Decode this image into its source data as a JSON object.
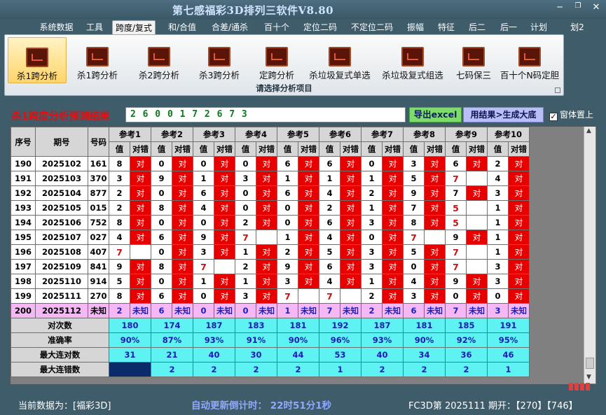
{
  "window": {
    "title": "第七感福彩3D排列三软件V8.80"
  },
  "menu": [
    "系统数据",
    "工具",
    "跨度/复式",
    "和/合值",
    "合差/通杀",
    "百十个",
    "定位二码",
    "不定位二码",
    "振幅",
    "特征",
    "后二",
    "后一",
    "计划",
    "划2"
  ],
  "ribbon": {
    "buttons": [
      "杀1跨分析",
      "杀1跨分析",
      "杀2跨分析",
      "杀3跨分析",
      "定跨分析",
      "杀垃圾复式单选",
      "杀垃圾复式组选",
      "七码保三",
      "百十个N码定胆"
    ],
    "caption": "请选择分析项目"
  },
  "result": {
    "title": "杀1跨度分析预测结果",
    "value": "2 6 0 0 1 7 2 6 7 3",
    "excel_label": "导出excel",
    "gen_label": "用结果>生成大底",
    "topmost_label": "窗体置上",
    "topmost_checked": "✓"
  },
  "grid": {
    "h_seq": "序号",
    "h_period": "期号",
    "h_num": "号码",
    "refs": [
      "参考1",
      "参考2",
      "参考3",
      "参考4",
      "参考5",
      "参考6",
      "参考7",
      "参考8",
      "参考9",
      "参考10"
    ],
    "sub_val": "值",
    "sub_res": "对错",
    "ok": "对",
    "unknown": "未知",
    "rows": [
      {
        "seq": "190",
        "period": "2025102",
        "num": "161",
        "cells": [
          [
            8,
            1
          ],
          [
            0,
            1
          ],
          [
            0,
            1
          ],
          [
            0,
            1
          ],
          [
            6,
            1
          ],
          [
            6,
            1
          ],
          [
            0,
            1
          ],
          [
            3,
            1
          ],
          [
            6,
            1
          ],
          [
            2,
            1
          ]
        ]
      },
      {
        "seq": "191",
        "period": "2025103",
        "num": "370",
        "cells": [
          [
            3,
            1
          ],
          [
            9,
            1
          ],
          [
            1,
            1
          ],
          [
            3,
            1
          ],
          [
            1,
            1
          ],
          [
            1,
            1
          ],
          [
            1,
            1
          ],
          [
            5,
            1
          ],
          [
            7,
            0
          ],
          [
            4,
            1
          ]
        ]
      },
      {
        "seq": "192",
        "period": "2025104",
        "num": "877",
        "cells": [
          [
            2,
            1
          ],
          [
            0,
            1
          ],
          [
            6,
            1
          ],
          [
            0,
            1
          ],
          [
            6,
            1
          ],
          [
            4,
            1
          ],
          [
            2,
            1
          ],
          [
            9,
            1
          ],
          [
            7,
            1
          ],
          [
            3,
            1
          ]
        ]
      },
      {
        "seq": "193",
        "period": "2025105",
        "num": "015",
        "cells": [
          [
            2,
            1
          ],
          [
            8,
            1
          ],
          [
            4,
            1
          ],
          [
            0,
            1
          ],
          [
            0,
            1
          ],
          [
            2,
            1
          ],
          [
            1,
            1
          ],
          [
            7,
            1
          ],
          [
            5,
            0
          ],
          [
            1,
            1
          ]
        ]
      },
      {
        "seq": "194",
        "period": "2025106",
        "num": "752",
        "cells": [
          [
            8,
            1
          ],
          [
            0,
            1
          ],
          [
            0,
            1
          ],
          [
            2,
            1
          ],
          [
            0,
            1
          ],
          [
            6,
            1
          ],
          [
            3,
            1
          ],
          [
            8,
            1
          ],
          [
            5,
            0
          ],
          [
            1,
            1
          ]
        ]
      },
      {
        "seq": "195",
        "period": "2025107",
        "num": "027",
        "cells": [
          [
            4,
            1
          ],
          [
            6,
            1
          ],
          [
            9,
            1
          ],
          [
            7,
            0
          ],
          [
            1,
            1
          ],
          [
            4,
            1
          ],
          [
            0,
            1
          ],
          [
            7,
            0
          ],
          [
            9,
            1
          ],
          [
            1,
            1
          ]
        ]
      },
      {
        "seq": "196",
        "period": "2025108",
        "num": "407",
        "cells": [
          [
            7,
            0
          ],
          [
            0,
            1
          ],
          [
            3,
            1
          ],
          [
            1,
            1
          ],
          [
            2,
            1
          ],
          [
            5,
            1
          ],
          [
            3,
            1
          ],
          [
            5,
            1
          ],
          [
            7,
            0
          ],
          [
            1,
            1
          ]
        ]
      },
      {
        "seq": "197",
        "period": "2025109",
        "num": "841",
        "cells": [
          [
            9,
            1
          ],
          [
            8,
            1
          ],
          [
            7,
            0
          ],
          [
            2,
            1
          ],
          [
            9,
            1
          ],
          [
            6,
            1
          ],
          [
            3,
            1
          ],
          [
            0,
            1
          ],
          [
            7,
            0
          ],
          [
            3,
            1
          ]
        ]
      },
      {
        "seq": "198",
        "period": "2025110",
        "num": "914",
        "cells": [
          [
            5,
            1
          ],
          [
            0,
            1
          ],
          [
            1,
            1
          ],
          [
            1,
            1
          ],
          [
            3,
            1
          ],
          [
            4,
            1
          ],
          [
            1,
            1
          ],
          [
            4,
            1
          ],
          [
            9,
            1
          ],
          [
            3,
            1
          ]
        ]
      },
      {
        "seq": "199",
        "period": "2025111",
        "num": "270",
        "cells": [
          [
            8,
            1
          ],
          [
            6,
            1
          ],
          [
            0,
            1
          ],
          [
            3,
            1
          ],
          [
            7,
            0
          ],
          [
            7,
            0
          ],
          [
            2,
            1
          ],
          [
            3,
            1
          ],
          [
            0,
            1
          ],
          [
            0,
            1
          ]
        ]
      }
    ],
    "pred": {
      "seq": "200",
      "period": "2025112",
      "num": "未知",
      "vals": [
        2,
        6,
        0,
        0,
        1,
        7,
        2,
        6,
        7,
        3
      ]
    },
    "stats": [
      {
        "label": "对次数",
        "vals": [
          "180",
          "174",
          "187",
          "183",
          "181",
          "192",
          "187",
          "181",
          "185",
          "191"
        ]
      },
      {
        "label": "准确率",
        "vals": [
          "90%",
          "87%",
          "93%",
          "91%",
          "90%",
          "96%",
          "93%",
          "90%",
          "92%",
          "95%"
        ]
      },
      {
        "label": "最大连对数",
        "vals": [
          "31",
          "21",
          "40",
          "30",
          "44",
          "53",
          "40",
          "34",
          "36",
          "46"
        ]
      },
      {
        "label": "最大连错数",
        "vals": [
          "",
          "2",
          "2",
          "2",
          "2",
          "1",
          "2",
          "2",
          "2",
          "1"
        ]
      }
    ]
  },
  "status": {
    "current": "当前数据为：[福彩3D]",
    "countdown": "自动更新倒计时：  22时51分1秒",
    "latest": "FC3D第 2025111 期开：【270】【746】"
  },
  "colors": {
    "ok_red": "#e80000",
    "stats_cyan": "#5ff2f2",
    "pred_pink": "#f4b8f4"
  }
}
